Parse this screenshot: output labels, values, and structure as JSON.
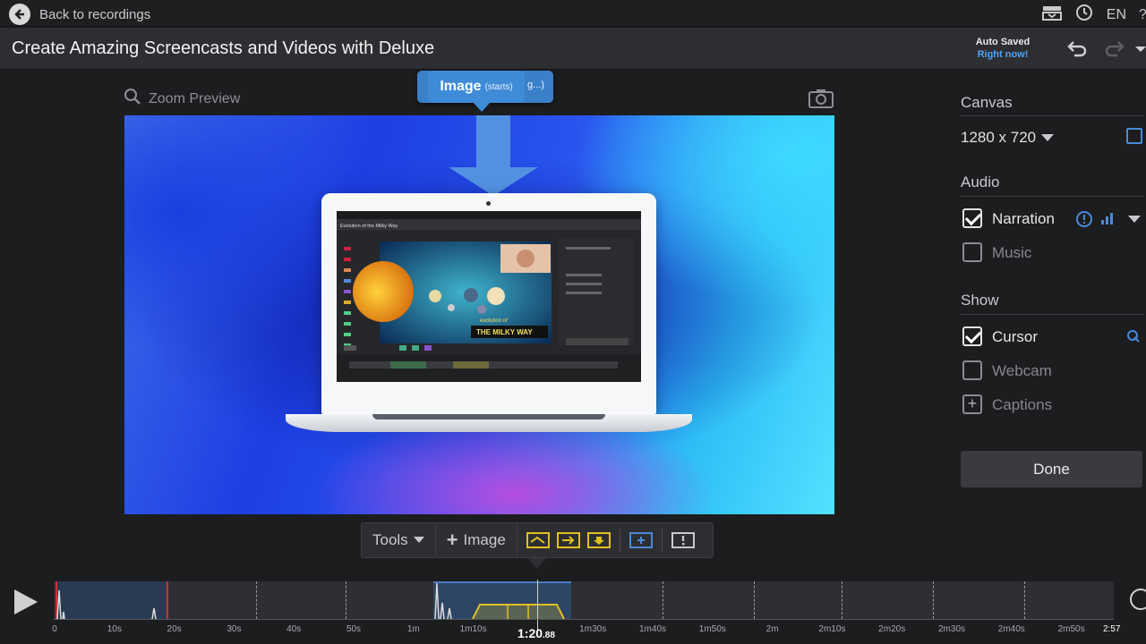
{
  "topbar": {
    "back_label": "Back to recordings",
    "lang": "EN"
  },
  "header": {
    "title": "Create Amazing Screencasts and Videos with Deluxe",
    "autosave_line1": "Auto Saved",
    "autosave_line2": "Right now!"
  },
  "preview": {
    "zoom_label": "Zoom Preview",
    "tooltip_main": "Image",
    "tooltip_sub": "(starts)",
    "tooltip_behind": "g...)",
    "inner_screen": {
      "title": "Evolution of the Milky Way",
      "banner_line1": "evolution of",
      "banner_line2": "THE MILKY WAY"
    }
  },
  "tools": {
    "tools_label": "Tools",
    "image_label": "Image"
  },
  "side": {
    "canvas_heading": "Canvas",
    "resolution": "1280 x 720",
    "audio_heading": "Audio",
    "narration_label": "Narration",
    "narration_checked": true,
    "music_label": "Music",
    "music_checked": false,
    "show_heading": "Show",
    "cursor_label": "Cursor",
    "cursor_checked": true,
    "webcam_label": "Webcam",
    "webcam_checked": false,
    "captions_label": "Captions",
    "done_label": "Done"
  },
  "timeline": {
    "ticks": [
      "0",
      "10s",
      "20s",
      "30s",
      "40s",
      "50s",
      "1m",
      "1m10s",
      "1m20s",
      "1m30s",
      "1m40s",
      "1m50s",
      "2m",
      "2m10s",
      "2m20s",
      "2m30s",
      "2m40s",
      "2m50s"
    ],
    "current_main": "1:20",
    "current_frac": ".88",
    "end": "2:57"
  },
  "colors": {
    "accent": "#3f8bd8",
    "link": "#4aa3ff",
    "clip_outline": "#e0c020",
    "marker_red": "#cc3333"
  }
}
